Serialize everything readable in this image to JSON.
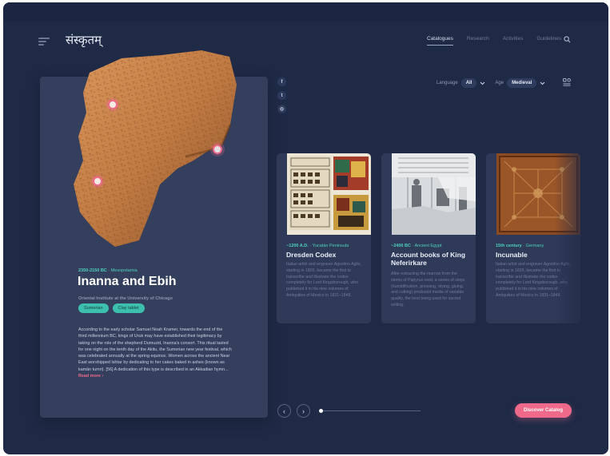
{
  "brand": {
    "logo_text": "संस्कृतम्"
  },
  "nav": {
    "items": [
      {
        "label": "Catalogues",
        "active": true
      },
      {
        "label": "Research",
        "active": false
      },
      {
        "label": "Activities",
        "active": false
      },
      {
        "label": "Guidelines",
        "active": false
      }
    ]
  },
  "social": {
    "facebook": "f",
    "twitter": "t",
    "instagram": "◎"
  },
  "filters": {
    "language_label": "Language",
    "language_value": "All",
    "age_label": "Age",
    "age_value": "Medieval"
  },
  "hero": {
    "date": "2350-2150 BC",
    "place": "Mesopotamia",
    "title": "Inanna and Ebih",
    "institution": "Oriental Institute at the University of Chicago",
    "tags": [
      "Sumerian",
      "Clay tablet"
    ],
    "description": "According to the early scholar Samuel Noah Kramer, towards the end of the third millennium BC, kings of Uruk may have established their legitimacy by taking on the role of the shepherd Dumuzid, Inanna's consort. This ritual lasted for one night on the tenth day of the Akitu, the Sumerian new year festival, which was celebrated annually at the spring equinox. Women across the ancient Near East worshipped Ishtar by dedicating to her cakes baked in ashes (known as kamān tumri). [56] A dedication of this type is described in an Akkadian hymn...",
    "read_more": "Read more ›"
  },
  "catalog": [
    {
      "date": "~1200 A.D.",
      "place": "Yucatán Peninsula",
      "title": "Dresden Codex",
      "description": "Italian artist and engraver Agostino Aglio, starting in 1826, became the first to transcribe and illustrate the codex completely for Lord Kingsborough, who published it in his nine volumes of Antiquities of Mexico in 1831–1848."
    },
    {
      "date": "~2400 BC",
      "place": "Ancient Egypt",
      "title": "Account books of King Neferirkare",
      "description": "After extracting the marrow from the stems of Papyrus reed, a series of steps (humidification, pressing, drying, gluing, and cutting) produced media of variable quality, the best being used for sacred writing."
    },
    {
      "date": "15th century",
      "place": "Germany",
      "title": "Incunable",
      "description": "Italian artist and engraver Agostino Aglio, starting in 1826, became the first to transcribe and illustrate the codex completely for Lord Kingsborough, who published it in his nine volumes of Antiquities of Mexico in 1831–1848."
    }
  ],
  "controls": {
    "prev": "‹",
    "next": "›",
    "discover": "Discover Catalog",
    "progress_fraction": 0.0
  },
  "colors": {
    "background": "#1f2a47",
    "accent_teal": "#4fd1bf",
    "accent_pink": "#ef6a8a"
  }
}
